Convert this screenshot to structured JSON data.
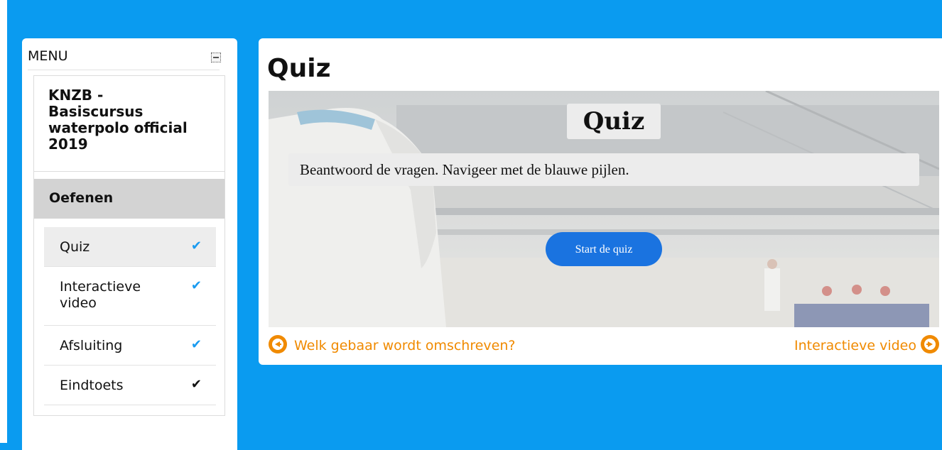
{
  "sidebar": {
    "menu_title": "MENU",
    "menu_toggle_icon": "collapse-icon",
    "course_title": "KNZB - Basiscursus waterpolo official 2019",
    "section_title": "Oefenen",
    "items": [
      {
        "label": "Quiz",
        "status_icon": "check-icon",
        "status_color": "#1a9bf0",
        "active": true
      },
      {
        "label": "Interactieve video",
        "status_icon": "check-icon",
        "status_color": "#1a9bf0",
        "active": false
      },
      {
        "label": "Afsluiting",
        "status_icon": "check-icon",
        "status_color": "#1a9bf0",
        "active": false
      },
      {
        "label": "Eindtoets",
        "status_icon": "check-icon",
        "status_color": "#111111",
        "active": false
      }
    ]
  },
  "main": {
    "page_title": "Quiz",
    "hero": {
      "title": "Quiz",
      "intro": "Beantwoord de vragen. Navigeer met de blauwe pijlen.",
      "start_label": "Start de quiz"
    },
    "prev_label": "Welk gebaar wordt omschreven?",
    "next_label": "Interactieve video"
  },
  "colors": {
    "background": "#0a9bf0",
    "accent_button": "#1a73e0",
    "nav_link": "#f08a00",
    "check_blue": "#1a9bf0"
  }
}
